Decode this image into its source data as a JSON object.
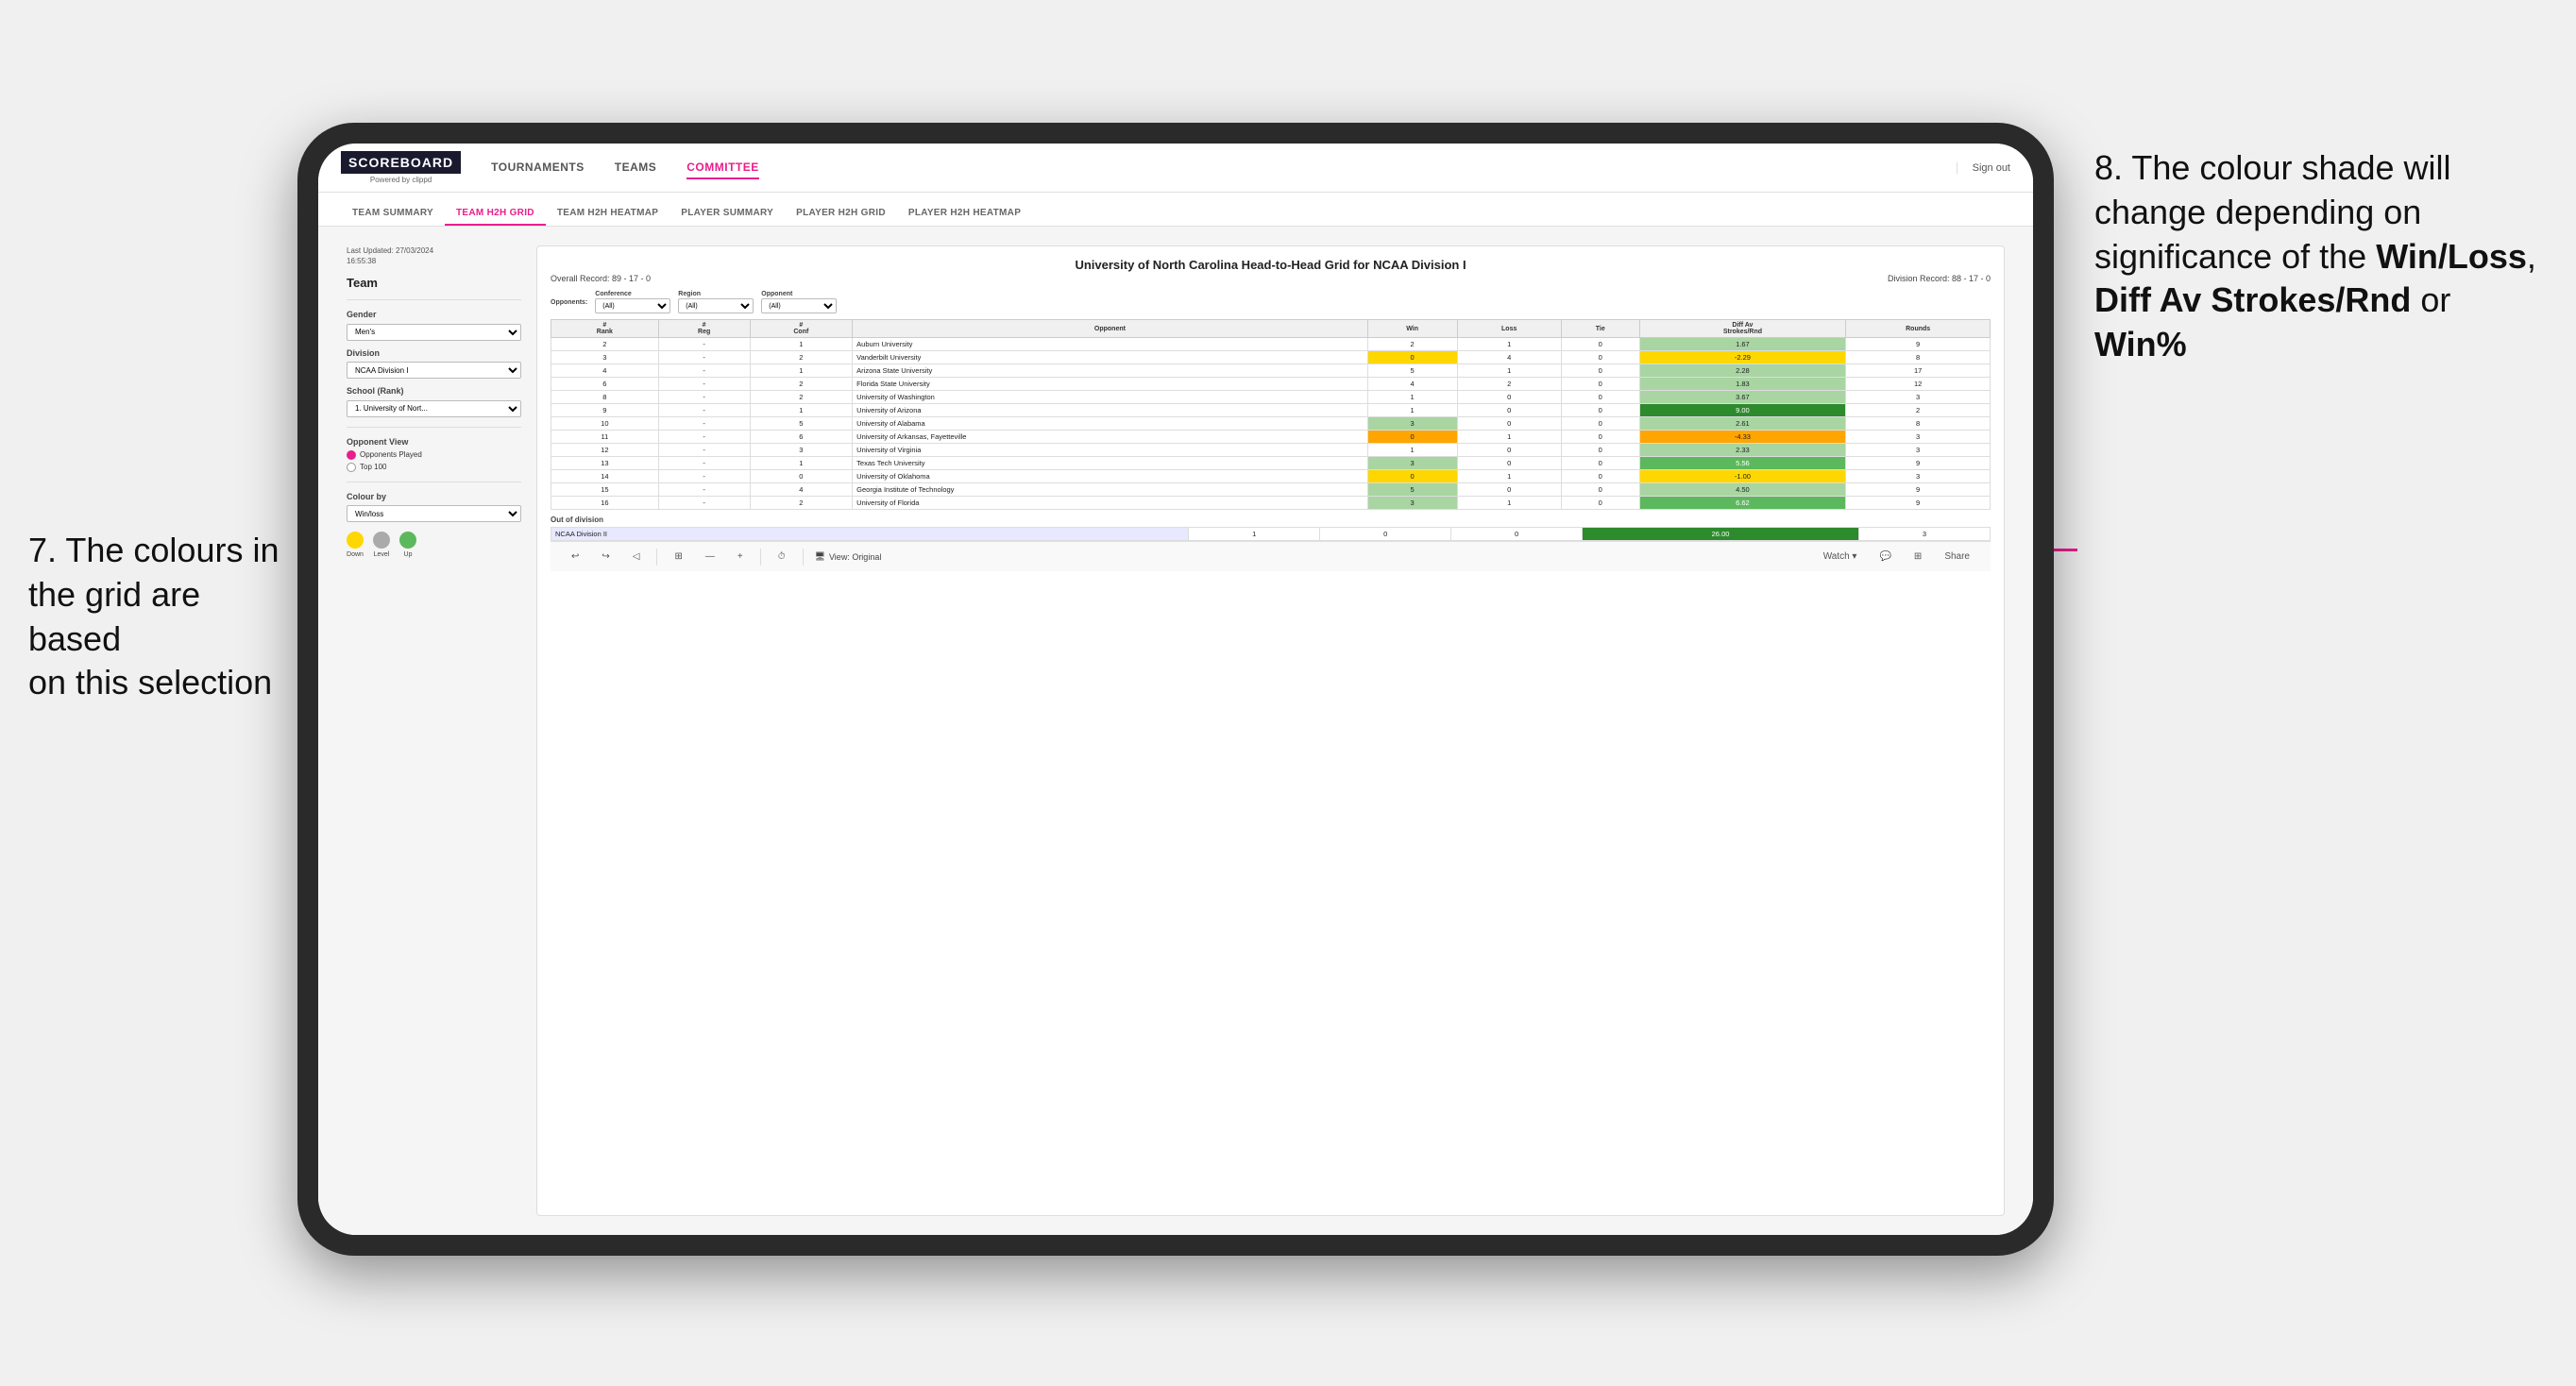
{
  "annotations": {
    "left": {
      "line1": "7. The colours in",
      "line2": "the grid are based",
      "line3": "on this selection"
    },
    "right": {
      "intro": "8. The colour shade will change depending on significance of the ",
      "bold1": "Win/Loss",
      "sep1": ", ",
      "bold2": "Diff Av Strokes/Rnd",
      "sep2": " or ",
      "bold3": "Win%"
    }
  },
  "header": {
    "logo": "SCOREBOARD",
    "logo_sub": "Powered by clippd",
    "nav": [
      "TOURNAMENTS",
      "TEAMS",
      "COMMITTEE"
    ],
    "active_nav": "COMMITTEE",
    "sign_out": "Sign out"
  },
  "sub_nav": {
    "items": [
      "TEAM SUMMARY",
      "TEAM H2H GRID",
      "TEAM H2H HEATMAP",
      "PLAYER SUMMARY",
      "PLAYER H2H GRID",
      "PLAYER H2H HEATMAP"
    ],
    "active": "TEAM H2H GRID"
  },
  "left_panel": {
    "timestamp": "Last Updated: 27/03/2024\n16:55:38",
    "team_label": "Team",
    "gender_label": "Gender",
    "gender_value": "Men's",
    "division_label": "Division",
    "division_value": "NCAA Division I",
    "school_label": "School (Rank)",
    "school_value": "1. University of Nort...",
    "opponent_view_label": "Opponent View",
    "opponent_options": [
      "Opponents Played",
      "Top 100"
    ],
    "opponent_selected": "Opponents Played",
    "colour_by_label": "Colour by",
    "colour_by_value": "Win/loss",
    "legend": {
      "down_label": "Down",
      "down_color": "#ffd700",
      "level_label": "Level",
      "level_color": "#aaaaaa",
      "up_label": "Up",
      "up_color": "#5cb85c"
    }
  },
  "grid": {
    "title": "University of North Carolina Head-to-Head Grid for NCAA Division I",
    "overall_record": "Overall Record: 89 - 17 - 0",
    "division_record": "Division Record: 88 - 17 - 0",
    "filters": {
      "opponents_label": "Opponents:",
      "conference_label": "Conference",
      "conference_value": "(All)",
      "region_label": "Region",
      "region_value": "(All)",
      "opponent_label": "Opponent",
      "opponent_value": "(All)"
    },
    "columns": [
      "#\nRank",
      "# Reg",
      "# Conf",
      "Opponent",
      "Win",
      "Loss",
      "Tie",
      "Diff Av\nStrokes/Rnd",
      "Rounds"
    ],
    "rows": [
      {
        "rank": "2",
        "reg": "-",
        "conf": "1",
        "opponent": "Auburn University",
        "win": "2",
        "loss": "1",
        "tie": "0",
        "diff": "1.67",
        "rounds": "9",
        "win_color": "bg-white",
        "diff_color": "bg-green-light"
      },
      {
        "rank": "3",
        "reg": "-",
        "conf": "2",
        "opponent": "Vanderbilt University",
        "win": "0",
        "loss": "4",
        "tie": "0",
        "diff": "-2.29",
        "rounds": "8",
        "win_color": "bg-yellow",
        "diff_color": "bg-yellow"
      },
      {
        "rank": "4",
        "reg": "-",
        "conf": "1",
        "opponent": "Arizona State University",
        "win": "5",
        "loss": "1",
        "tie": "0",
        "diff": "2.28",
        "rounds": "17",
        "win_color": "bg-white",
        "diff_color": "bg-green-light"
      },
      {
        "rank": "6",
        "reg": "-",
        "conf": "2",
        "opponent": "Florida State University",
        "win": "4",
        "loss": "2",
        "tie": "0",
        "diff": "1.83",
        "rounds": "12",
        "win_color": "bg-white",
        "diff_color": "bg-green-light"
      },
      {
        "rank": "8",
        "reg": "-",
        "conf": "2",
        "opponent": "University of Washington",
        "win": "1",
        "loss": "0",
        "tie": "0",
        "diff": "3.67",
        "rounds": "3",
        "win_color": "bg-white",
        "diff_color": "bg-green-light"
      },
      {
        "rank": "9",
        "reg": "-",
        "conf": "1",
        "opponent": "University of Arizona",
        "win": "1",
        "loss": "0",
        "tie": "0",
        "diff": "9.00",
        "rounds": "2",
        "win_color": "bg-white",
        "diff_color": "bg-green-dark"
      },
      {
        "rank": "10",
        "reg": "-",
        "conf": "5",
        "opponent": "University of Alabama",
        "win": "3",
        "loss": "0",
        "tie": "0",
        "diff": "2.61",
        "rounds": "8",
        "win_color": "bg-green-light",
        "diff_color": "bg-green-light"
      },
      {
        "rank": "11",
        "reg": "-",
        "conf": "6",
        "opponent": "University of Arkansas, Fayetteville",
        "win": "0",
        "loss": "1",
        "tie": "0",
        "diff": "-4.33",
        "rounds": "3",
        "win_color": "bg-orange",
        "diff_color": "bg-orange"
      },
      {
        "rank": "12",
        "reg": "-",
        "conf": "3",
        "opponent": "University of Virginia",
        "win": "1",
        "loss": "0",
        "tie": "0",
        "diff": "2.33",
        "rounds": "3",
        "win_color": "bg-white",
        "diff_color": "bg-green-light"
      },
      {
        "rank": "13",
        "reg": "-",
        "conf": "1",
        "opponent": "Texas Tech University",
        "win": "3",
        "loss": "0",
        "tie": "0",
        "diff": "5.56",
        "rounds": "9",
        "win_color": "bg-green-light",
        "diff_color": "bg-green-mid"
      },
      {
        "rank": "14",
        "reg": "-",
        "conf": "0",
        "opponent": "University of Oklahoma",
        "win": "0",
        "loss": "1",
        "tie": "0",
        "diff": "-1.00",
        "rounds": "3",
        "win_color": "bg-yellow",
        "diff_color": "bg-yellow"
      },
      {
        "rank": "15",
        "reg": "-",
        "conf": "4",
        "opponent": "Georgia Institute of Technology",
        "win": "5",
        "loss": "0",
        "tie": "0",
        "diff": "4.50",
        "rounds": "9",
        "win_color": "bg-green-light",
        "diff_color": "bg-green-light"
      },
      {
        "rank": "16",
        "reg": "-",
        "conf": "2",
        "opponent": "University of Florida",
        "win": "3",
        "loss": "1",
        "tie": "0",
        "diff": "6.62",
        "rounds": "9",
        "win_color": "bg-green-light",
        "diff_color": "bg-green-mid"
      }
    ],
    "out_of_division": {
      "label": "Out of division",
      "row": {
        "name": "NCAA Division II",
        "win": "1",
        "loss": "0",
        "tie": "0",
        "diff": "26.00",
        "rounds": "3",
        "diff_color": "bg-green-dark"
      }
    }
  },
  "bottom_toolbar": {
    "undo": "↩",
    "redo": "↪",
    "view_label": "View: Original",
    "watch": "Watch ▾",
    "share": "Share"
  }
}
